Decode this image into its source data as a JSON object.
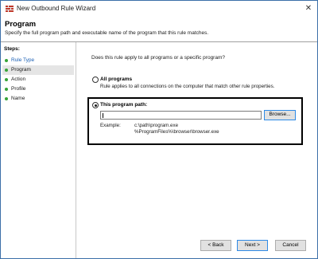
{
  "window": {
    "title": "New Outbound Rule Wizard",
    "close_glyph": "✕"
  },
  "header": {
    "title": "Program",
    "description": "Specify the full program path and executable name of the program that this rule matches."
  },
  "steps": {
    "heading": "Steps:",
    "items": [
      {
        "label": "Rule Type",
        "state": "completed-link"
      },
      {
        "label": "Program",
        "state": "current"
      },
      {
        "label": "Action",
        "state": "pending"
      },
      {
        "label": "Profile",
        "state": "pending"
      },
      {
        "label": "Name",
        "state": "pending"
      }
    ]
  },
  "main": {
    "question": "Does this rule apply to all programs or a specific program?",
    "option_all": {
      "label": "All programs",
      "description": "Rule applies to all connections on the computer that match other rule properties.",
      "selected": false
    },
    "option_path": {
      "label": "This program path:",
      "selected": true,
      "value": "",
      "browse_label": "Browse..."
    },
    "example": {
      "label": "Example:",
      "lines": [
        "c:\\path\\program.exe",
        "%ProgramFiles%\\browser\\browser.exe"
      ]
    }
  },
  "footer": {
    "back_label": "< Back",
    "next_label": "Next >",
    "cancel_label": "Cancel"
  },
  "colors": {
    "accent": "#2e8ae6",
    "step_dot": "#37a437",
    "link": "#1a5fb4"
  }
}
